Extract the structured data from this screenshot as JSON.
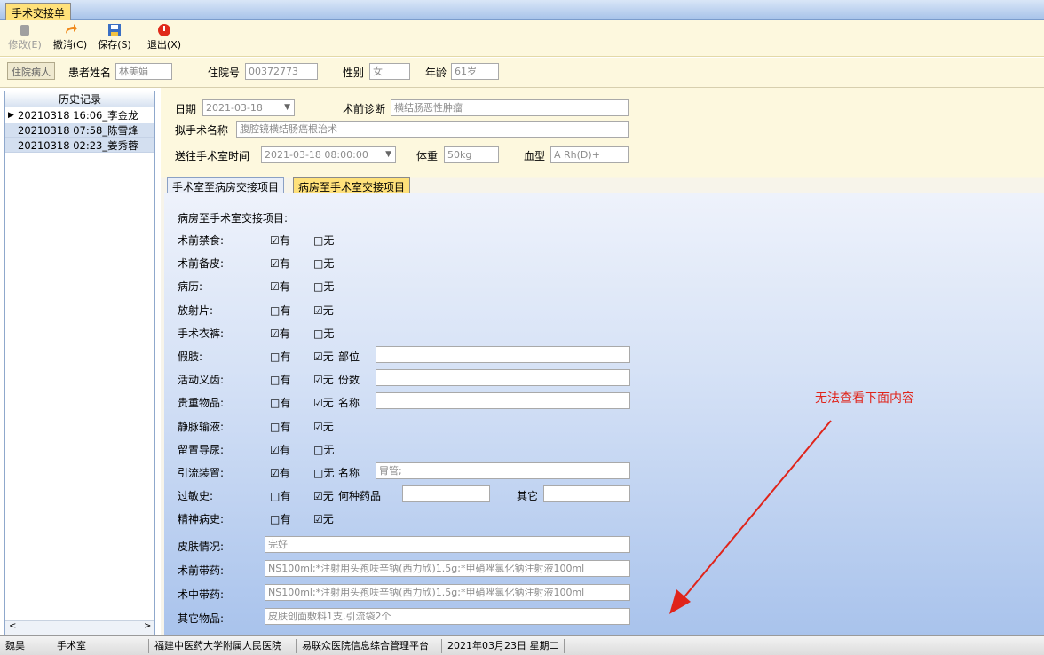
{
  "tab_title": "手术交接单",
  "toolbar": {
    "modify": "修改(E)",
    "cancel": "撤消(C)",
    "save": "保存(S)",
    "exit": "退出(X)"
  },
  "patient": {
    "inpatient_button": "住院病人",
    "name_label": "患者姓名",
    "name_value": "林美娟",
    "admission_label": "住院号",
    "admission_value": "00372773",
    "gender_label": "性别",
    "gender_value": "女",
    "age_label": "年龄",
    "age_value": "61岁"
  },
  "history": {
    "header": "历史记录",
    "rows": [
      "20210318 16:06_李金龙",
      "20210318 07:58_陈雪烽",
      "20210318 02:23_姜秀蓉"
    ]
  },
  "surgery": {
    "date_label": "日期",
    "date_value": "2021-03-18",
    "diagnosis_label": "术前诊断",
    "diagnosis_value": "横结肠恶性肿瘤",
    "operation_label": "拟手术名称",
    "operation_value": "腹腔镜横结肠癌根治术",
    "send_time_label": "送往手术室时间",
    "send_time_value": "2021-03-18 08:00:00",
    "weight_label": "体重",
    "weight_value": "50kg",
    "blood_label": "血型",
    "blood_value": "A Rh(D)+"
  },
  "inner_tabs": [
    "手术室至病房交接项目",
    "病房至手术室交接项目"
  ],
  "handover": {
    "section_title": "病房至手术室交接项目:",
    "yes": "有",
    "no": "无",
    "checked_box": "☑",
    "unchecked_box": "□",
    "items": [
      {
        "label": "术前禁食:",
        "yes": true
      },
      {
        "label": "术前备皮:",
        "yes": true
      },
      {
        "label": "病历:",
        "yes": true
      },
      {
        "label": "放射片:",
        "yes": false
      },
      {
        "label": "手术衣裤:",
        "yes": true
      },
      {
        "label": "假肢:",
        "yes": false,
        "extra_label": "部位",
        "extra_value": ""
      },
      {
        "label": "活动义齿:",
        "yes": false,
        "extra_label": "份数",
        "extra_value": ""
      },
      {
        "label": "贵重物品:",
        "yes": false,
        "extra_label": "名称",
        "extra_value": ""
      },
      {
        "label": "静脉输液:",
        "yes": false
      },
      {
        "label": "留置导尿:",
        "yes": true
      },
      {
        "label": "引流装置:",
        "yes": true,
        "extra_label": "名称",
        "extra_value": "胃管;"
      },
      {
        "label": "过敏史:",
        "yes": false,
        "extra_label": "何种药品",
        "extra_value": "",
        "extra2_label": "其它",
        "extra2_value": ""
      },
      {
        "label": "精神病史:",
        "yes": false
      }
    ],
    "skin_label": "皮肤情况:",
    "skin_value": "完好",
    "preop_drug_label": "术前带药:",
    "preop_drug_value": "NS100ml;*注射用头孢呋辛钠(西力欣)1.5g;*甲硝唑氯化钠注射液100ml",
    "intraop_drug_label": "术中带药:",
    "intraop_drug_value": "NS100ml;*注射用头孢呋辛钠(西力欣)1.5g;*甲硝唑氯化钠注射液100ml",
    "other_label": "其它物品:",
    "other_value": "皮肤创面敷料1支,引流袋2个"
  },
  "annotation": {
    "text": "无法查看下面内容",
    "color": "#e0241a"
  },
  "statusbar": [
    "魏昊",
    "手术室",
    "福建中医药大学附属人民医院",
    "易联众医院信息综合管理平台",
    "2021年03月23日 星期二"
  ]
}
